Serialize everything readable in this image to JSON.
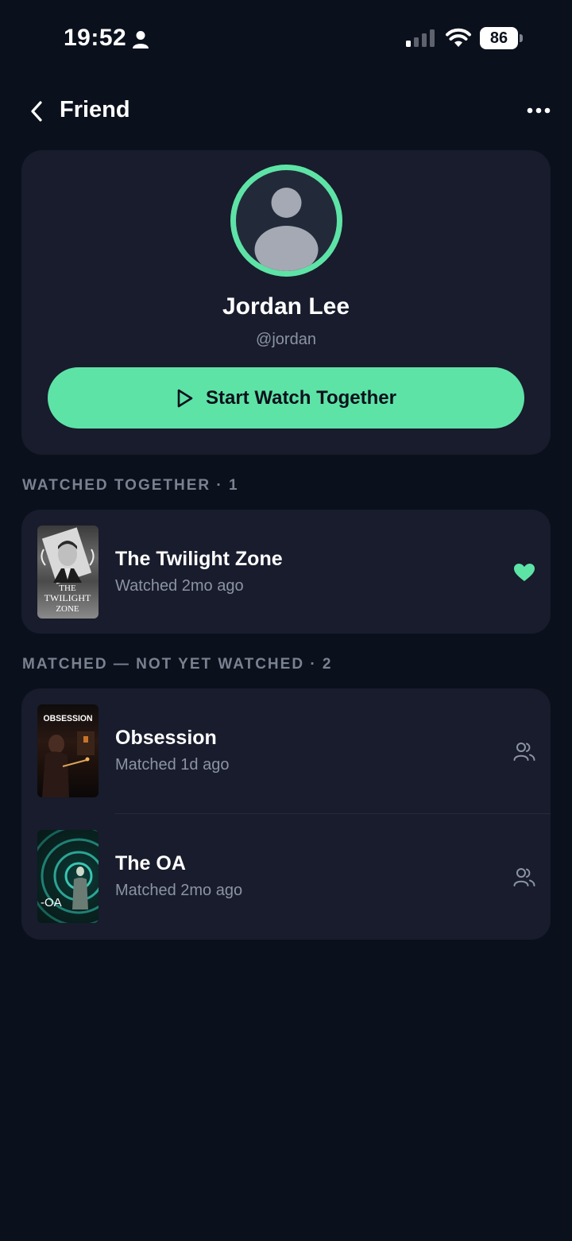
{
  "status_bar": {
    "time": "19:52",
    "battery": "86"
  },
  "nav": {
    "title": "Friend"
  },
  "profile": {
    "name": "Jordan Lee",
    "handle": "@jordan",
    "cta_label": "Start Watch Together"
  },
  "sections": {
    "watched": {
      "header": "WATCHED TOGETHER · 1",
      "items": [
        {
          "title": "The Twilight Zone",
          "subtitle": "Watched 2mo ago",
          "poster_text": [
            "THE",
            "TWILIGHT",
            "ZONE"
          ],
          "icon": "heart-icon"
        }
      ]
    },
    "matched": {
      "header": "MATCHED — NOT YET WATCHED · 2",
      "items": [
        {
          "title": "Obsession",
          "subtitle": "Matched 1d ago",
          "poster_text": "OBSESSION",
          "icon": "people-icon"
        },
        {
          "title": "The OA",
          "subtitle": "Matched 2mo ago",
          "poster_text": "-OA",
          "icon": "people-icon"
        }
      ]
    }
  },
  "colors": {
    "background": "#0b111c",
    "card": "#181c2c",
    "accent": "#5ee3a6",
    "muted_text": "#8c93a2",
    "section_header": "#7a8190"
  }
}
